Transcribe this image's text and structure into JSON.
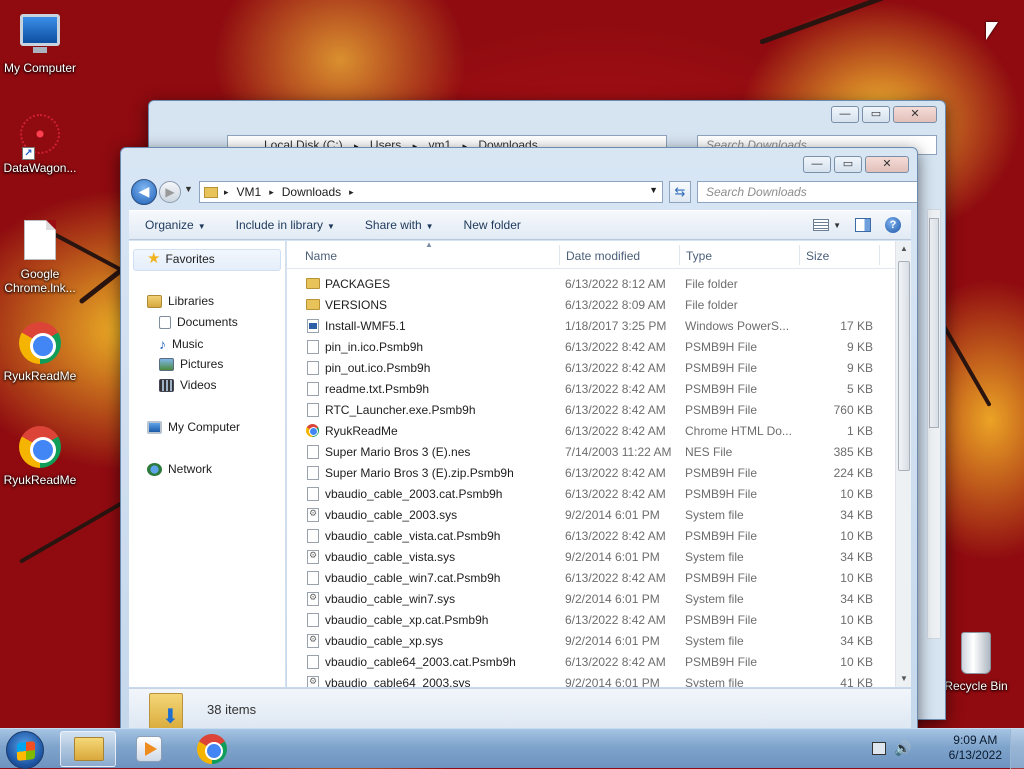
{
  "desktop": {
    "icons": [
      {
        "label": "My Computer",
        "icon": "computer-icon"
      },
      {
        "label": "DataWagon...",
        "icon": "datawagon-icon"
      },
      {
        "label": "Google Chrome.lnk...",
        "icon": "file-icon"
      },
      {
        "label": "RyukReadMe",
        "icon": "chrome-icon"
      },
      {
        "label": "RyukReadMe",
        "icon": "chrome-icon"
      },
      {
        "label": "Recycle Bin",
        "icon": "recycle-bin-icon"
      }
    ]
  },
  "back_window": {
    "address": [
      "Local Disk (C:)",
      "Users",
      "vm1",
      "Downloads"
    ],
    "search_placeholder": "Search Downloads"
  },
  "window": {
    "address": {
      "crumbs": [
        "VM1",
        "Downloads"
      ]
    },
    "search_placeholder": "Search Downloads",
    "caption": {
      "minimize": "—",
      "maximize": "▭",
      "close": "✕"
    },
    "toolbar": {
      "organize": "Organize",
      "include_in_library": "Include in library",
      "share_with": "Share with",
      "new_folder": "New folder"
    },
    "nav": {
      "favorites": "Favorites",
      "libraries": "Libraries",
      "documents": "Documents",
      "music": "Music",
      "pictures": "Pictures",
      "videos": "Videos",
      "my_computer": "My Computer",
      "network": "Network"
    },
    "columns": {
      "name": "Name",
      "date": "Date modified",
      "type": "Type",
      "size": "Size"
    },
    "files": [
      {
        "name": "PACKAGES",
        "date": "6/13/2022 8:12 AM",
        "type": "File folder",
        "size": "",
        "icon": "folder"
      },
      {
        "name": "VERSIONS",
        "date": "6/13/2022 8:09 AM",
        "type": "File folder",
        "size": "",
        "icon": "folder"
      },
      {
        "name": "Install-WMF5.1",
        "date": "1/18/2017 3:25 PM",
        "type": "Windows PowerS...",
        "size": "17 KB",
        "icon": "ps"
      },
      {
        "name": "pin_in.ico.Psmb9h",
        "date": "6/13/2022 8:42 AM",
        "type": "PSMB9H File",
        "size": "9 KB",
        "icon": "file"
      },
      {
        "name": "pin_out.ico.Psmb9h",
        "date": "6/13/2022 8:42 AM",
        "type": "PSMB9H File",
        "size": "9 KB",
        "icon": "file"
      },
      {
        "name": "readme.txt.Psmb9h",
        "date": "6/13/2022 8:42 AM",
        "type": "PSMB9H File",
        "size": "5 KB",
        "icon": "file"
      },
      {
        "name": "RTC_Launcher.exe.Psmb9h",
        "date": "6/13/2022 8:42 AM",
        "type": "PSMB9H File",
        "size": "760 KB",
        "icon": "file"
      },
      {
        "name": "RyukReadMe",
        "date": "6/13/2022 8:42 AM",
        "type": "Chrome HTML Do...",
        "size": "1 KB",
        "icon": "chrome"
      },
      {
        "name": "Super Mario Bros 3 (E).nes",
        "date": "7/14/2003 11:22 AM",
        "type": "NES File",
        "size": "385 KB",
        "icon": "file"
      },
      {
        "name": "Super Mario Bros 3 (E).zip.Psmb9h",
        "date": "6/13/2022 8:42 AM",
        "type": "PSMB9H File",
        "size": "224 KB",
        "icon": "file"
      },
      {
        "name": "vbaudio_cable_2003.cat.Psmb9h",
        "date": "6/13/2022 8:42 AM",
        "type": "PSMB9H File",
        "size": "10 KB",
        "icon": "file"
      },
      {
        "name": "vbaudio_cable_2003.sys",
        "date": "9/2/2014 6:01 PM",
        "type": "System file",
        "size": "34 KB",
        "icon": "sys"
      },
      {
        "name": "vbaudio_cable_vista.cat.Psmb9h",
        "date": "6/13/2022 8:42 AM",
        "type": "PSMB9H File",
        "size": "10 KB",
        "icon": "file"
      },
      {
        "name": "vbaudio_cable_vista.sys",
        "date": "9/2/2014 6:01 PM",
        "type": "System file",
        "size": "34 KB",
        "icon": "sys"
      },
      {
        "name": "vbaudio_cable_win7.cat.Psmb9h",
        "date": "6/13/2022 8:42 AM",
        "type": "PSMB9H File",
        "size": "10 KB",
        "icon": "file"
      },
      {
        "name": "vbaudio_cable_win7.sys",
        "date": "9/2/2014 6:01 PM",
        "type": "System file",
        "size": "34 KB",
        "icon": "sys"
      },
      {
        "name": "vbaudio_cable_xp.cat.Psmb9h",
        "date": "6/13/2022 8:42 AM",
        "type": "PSMB9H File",
        "size": "10 KB",
        "icon": "file"
      },
      {
        "name": "vbaudio_cable_xp.sys",
        "date": "9/2/2014 6:01 PM",
        "type": "System file",
        "size": "34 KB",
        "icon": "sys"
      },
      {
        "name": "vbaudio_cable64_2003.cat.Psmb9h",
        "date": "6/13/2022 8:42 AM",
        "type": "PSMB9H File",
        "size": "10 KB",
        "icon": "file"
      },
      {
        "name": "vbaudio_cable64_2003.sys",
        "date": "9/2/2014 6:01 PM",
        "type": "System file",
        "size": "41 KB",
        "icon": "sys"
      }
    ],
    "status": {
      "item_count": "38 items"
    }
  },
  "taskbar": {
    "clock_time": "9:09 AM",
    "clock_date": "6/13/2022"
  }
}
